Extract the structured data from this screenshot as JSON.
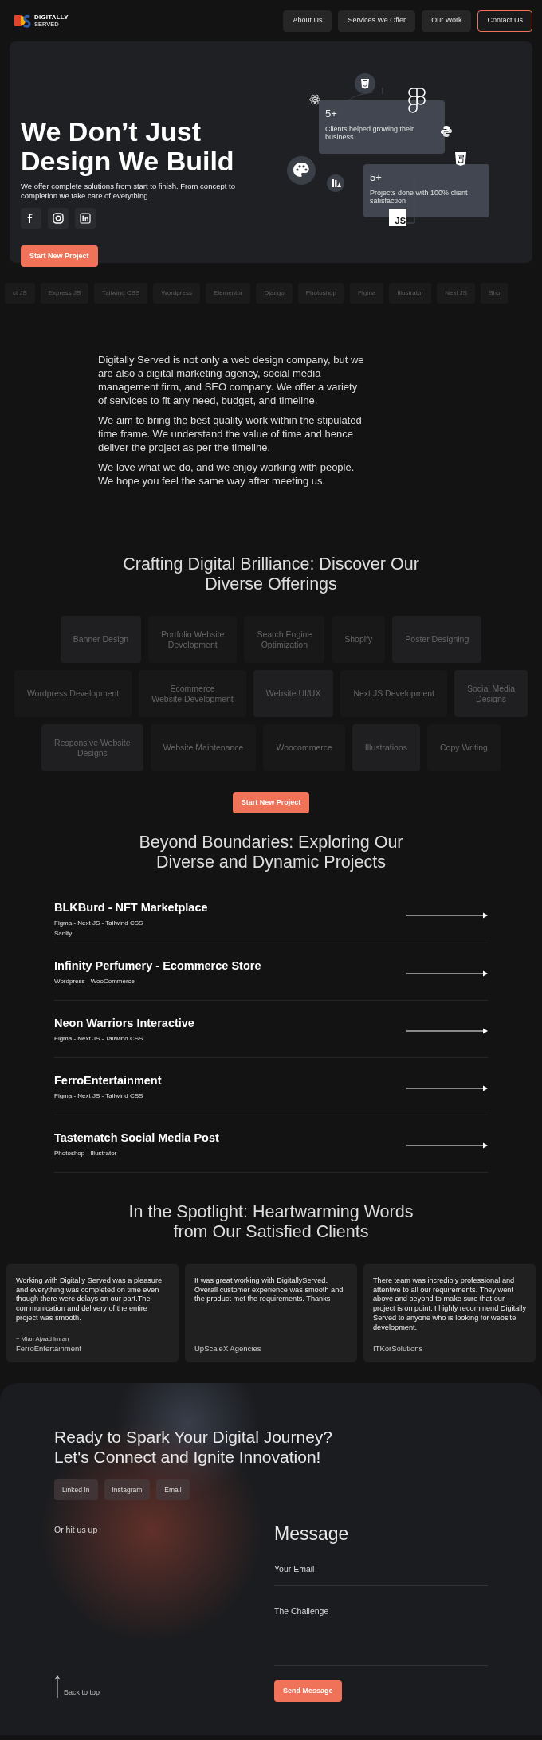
{
  "nav": {
    "logo": {
      "name": "DIGITALLY",
      "tagline": "SERVED"
    },
    "links": [
      {
        "label": "About Us",
        "kind": "plain"
      },
      {
        "label": "Services We Offer",
        "kind": "plain"
      },
      {
        "label": "Our Work",
        "kind": "plain"
      },
      {
        "label": "Contact Us",
        "kind": "outline"
      }
    ]
  },
  "hero": {
    "title": "We Don’t Just Design We Build",
    "subtitle": "We offer complete solutions from start to finish. From concept to completion we take care of everything.",
    "socials": [
      {
        "kind": "facebook"
      },
      {
        "kind": "instagram"
      },
      {
        "kind": "linkedin"
      }
    ],
    "button": "Start New Project",
    "stats": [
      {
        "value": "5+",
        "label": "Clients helped growing their business"
      },
      {
        "value": "5+",
        "label": "Projects done with 100% client satisfaction"
      }
    ],
    "badge": "JS"
  },
  "tech": [
    "ct JS",
    "Express JS",
    "Tailwind CSS",
    "Wordpress",
    "Elementor",
    "Django",
    "Photoshop",
    "Figma",
    "Illustrator",
    "Next JS",
    "Sho"
  ],
  "about": [
    "Digitally Served is not only a web design company, but we are also a digital marketing agency, social media management firm, and SEO company. We offer a variety of services to fit any need, budget, and timeline.",
    "We aim to bring the best quality work within the stipulated time frame. We understand the value of time and hence deliver the project as per the timeline.",
    "We love what we do, and we enjoy working with people. We hope you feel the same way after meeting us."
  ],
  "services": {
    "title": [
      "Crafting Digital Brilliance: Discover Our",
      "Diverse Offerings"
    ],
    "rows": [
      [
        {
          "lines": [
            "Banner Design"
          ],
          "kind": "light"
        },
        {
          "lines": [
            "Portfolio Website",
            "Development"
          ],
          "kind": "dark"
        },
        {
          "lines": [
            "Search Engine",
            "Optimization"
          ],
          "kind": "dark"
        },
        {
          "lines": [
            "Shopify"
          ],
          "kind": "dark"
        },
        {
          "lines": [
            "Poster Designing"
          ],
          "kind": "light"
        }
      ],
      [
        {
          "lines": [
            "Wordpress Development"
          ],
          "kind": "dark"
        },
        {
          "lines": [
            "Ecommerce",
            "Website Development"
          ],
          "kind": "dark"
        },
        {
          "lines": [
            "Website UI/UX"
          ],
          "kind": "light"
        },
        {
          "lines": [
            "Next JS Development"
          ],
          "kind": "dark"
        },
        {
          "lines": [
            "Social Media",
            "Designs"
          ],
          "kind": "light"
        }
      ],
      [
        {
          "lines": [
            "Responsive Website",
            "Designs"
          ],
          "kind": "light"
        },
        {
          "lines": [
            "Website Maintenance"
          ],
          "kind": "dark"
        },
        {
          "lines": [
            "Woocommerce"
          ],
          "kind": "dark"
        },
        {
          "lines": [
            "Illustrations"
          ],
          "kind": "light"
        },
        {
          "lines": [
            "Copy Writing"
          ],
          "kind": "dark"
        }
      ]
    ],
    "button": "Start New Project"
  },
  "projects": {
    "title": [
      "Beyond Boundaries: Exploring Our",
      "Diverse and Dynamic Projects"
    ],
    "items": [
      {
        "title": "BLKBurd - NFT Marketplace",
        "tags": [
          "Figma - Next JS - Tailwind CSS",
          "Sanity"
        ]
      },
      {
        "title": "Infinity Perfumery - Ecommerce Store",
        "tags": [
          "Wordpress - WooCommerce"
        ]
      },
      {
        "title": "Neon Warriors Interactive",
        "tags": [
          "Figma - Next JS - Tailwind CSS"
        ]
      },
      {
        "title": "FerroEntertainment",
        "tags": [
          "Figma - Next JS - Tailwind CSS"
        ]
      },
      {
        "title": "Tastematch Social Media Post",
        "tags": [
          "Photoshop - Illustrator"
        ]
      }
    ]
  },
  "testimonials": {
    "title": [
      "In the Spotlight: Heartwarming Words",
      "from Our Satisfied Clients"
    ],
    "items": [
      {
        "quote": "Working with Digitally Served was a pleasure and everything was completed on time even though there were delays on our part.The communication and delivery of the entire project was smooth.",
        "author": "~ Mian Ajwad Imran",
        "company": "FerroEntertainment"
      },
      {
        "quote": "It was great working with DigitallyServed. Overall customer experience was smooth and the product met the requirements. Thanks",
        "company": "UpScaleX Agencies"
      },
      {
        "quote": "There team was incredibly professional and attentive to all our requirements. They went above and beyond to make sure that our project is on point. I highly recommend Digitally Served to anyone who is looking for website development.",
        "company": "ITKorSolutions"
      }
    ]
  },
  "contact": {
    "title": [
      "Ready to Spark Your Digital Journey?",
      "Let's Connect and Ignite Innovation!"
    ],
    "links": [
      "Linked In",
      "Instagram",
      "Email"
    ],
    "aside": "Or hit us up",
    "form": {
      "title": "Message",
      "fields": [
        {
          "placeholder": "Your Email",
          "kind": "input"
        },
        {
          "placeholder": "The Challenge",
          "kind": "textarea"
        }
      ],
      "submit": "Send Message"
    },
    "back": "Back to top"
  }
}
